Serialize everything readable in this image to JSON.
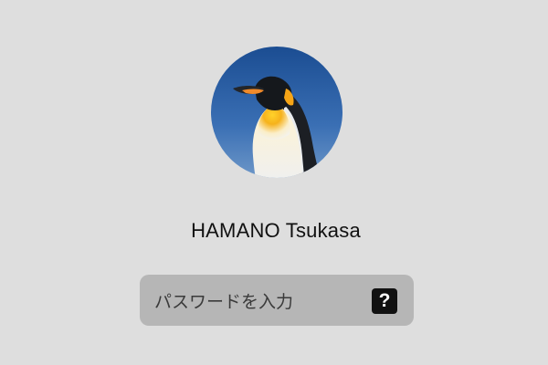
{
  "login": {
    "user_name": "HAMANO Tsukasa",
    "password_placeholder": "パスワードを入力",
    "hint_button_label": "?"
  },
  "colors": {
    "background": "#dedede",
    "field": "#b6b6b6",
    "hint_button": "#111111"
  }
}
